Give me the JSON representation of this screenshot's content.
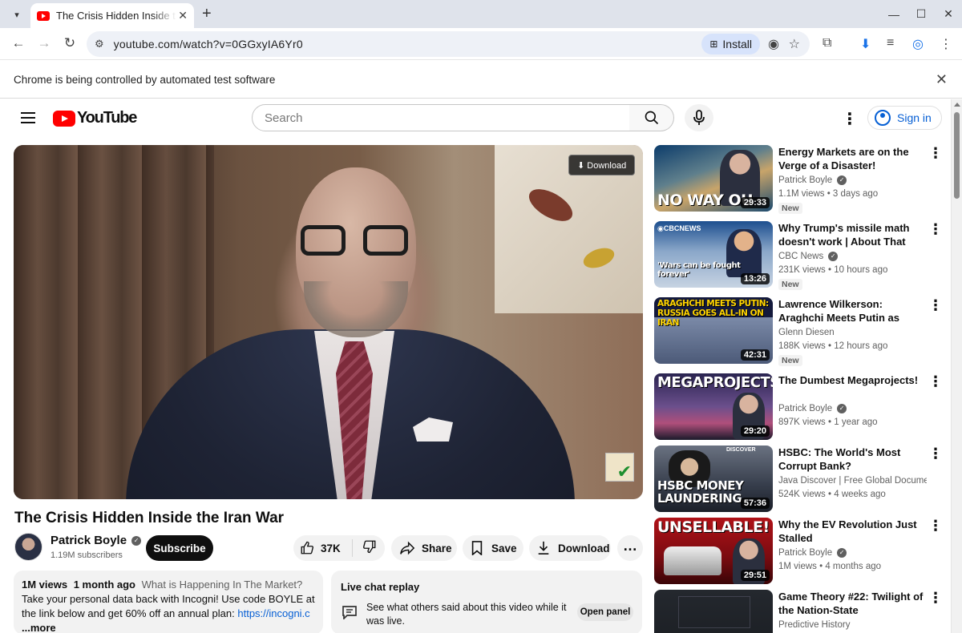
{
  "browser": {
    "tab_title": "The Crisis Hidden Inside the Iran War",
    "url": "youtube.com/watch?v=0GGxyIA6Yr0",
    "install_label": "Install",
    "infobar_text": "Chrome is being controlled by automated test software"
  },
  "header": {
    "logo_text": "YouTube",
    "search_placeholder": "Search",
    "signin_label": "Sign in"
  },
  "player": {
    "download_chip": "⬇ Download"
  },
  "video": {
    "title": "The Crisis Hidden Inside the Iran War",
    "channel": "Patrick Boyle",
    "subscribers": "1.19M subscribers",
    "subscribe_label": "Subscribe",
    "likes": "37K",
    "share_label": "Share",
    "save_label": "Save",
    "download_label": "Download"
  },
  "description": {
    "views": "1M views",
    "age": "1 month ago",
    "headline": "What is Happening In The Market?",
    "text": "Take your personal data back with Incogni! Use code BOYLE at the link below and get 60% off an annual plan: ",
    "link": "https://incogni.c",
    "more_label": "...more"
  },
  "live_chat": {
    "title": "Live chat replay",
    "text": "See what others said about this video while it was live.",
    "button": "Open panel"
  },
  "recommendations": [
    {
      "title": "Energy Markets are on the Verge of a Disaster!",
      "channel": "Patrick Boyle",
      "verified": true,
      "views": "1.1M views • 3 days ago",
      "badge": "New",
      "duration": "29:33",
      "thumb_text": "NO WAY OU"
    },
    {
      "title": "Why Trump's missile math doesn't work | About That",
      "channel": "CBC News",
      "verified": true,
      "views": "231K views • 10 hours ago",
      "badge": "New",
      "duration": "13:26",
      "thumb_text": "'Wars can be fought forever'"
    },
    {
      "title": "Lawrence Wilkerson: Araghchi Meets Putin as Russia Goes Al…",
      "channel": "Glenn Diesen",
      "verified": false,
      "views": "188K views • 12 hours ago",
      "badge": "New",
      "duration": "42:31",
      "thumb_text": "ARAGHCHI MEETS PUTIN: RUSSIA GOES ALL-IN ON IRAN"
    },
    {
      "title": "The Dumbest Megaprojects!",
      "channel": "Patrick Boyle",
      "verified": true,
      "views": "897K views • 1 year ago",
      "badge": "",
      "duration": "29:20",
      "thumb_text": "MEGAPROJECTS"
    },
    {
      "title": "HSBC: The World's Most Corrupt Bank?",
      "channel": "Java Discover | Free Global Documentari…",
      "verified": false,
      "views": "524K views • 4 weeks ago",
      "badge": "",
      "duration": "57:36",
      "thumb_text": "HSBC MONEY LAUNDERING"
    },
    {
      "title": "Why the EV Revolution Just Stalled",
      "channel": "Patrick Boyle",
      "verified": true,
      "views": "1M views • 4 months ago",
      "badge": "",
      "duration": "29:51",
      "thumb_text": "UNSELLABLE!"
    },
    {
      "title": "Game Theory #22:  Twilight of the Nation-State",
      "channel": "Predictive History",
      "verified": false,
      "views": "",
      "badge": "",
      "duration": "",
      "thumb_text": ""
    }
  ]
}
